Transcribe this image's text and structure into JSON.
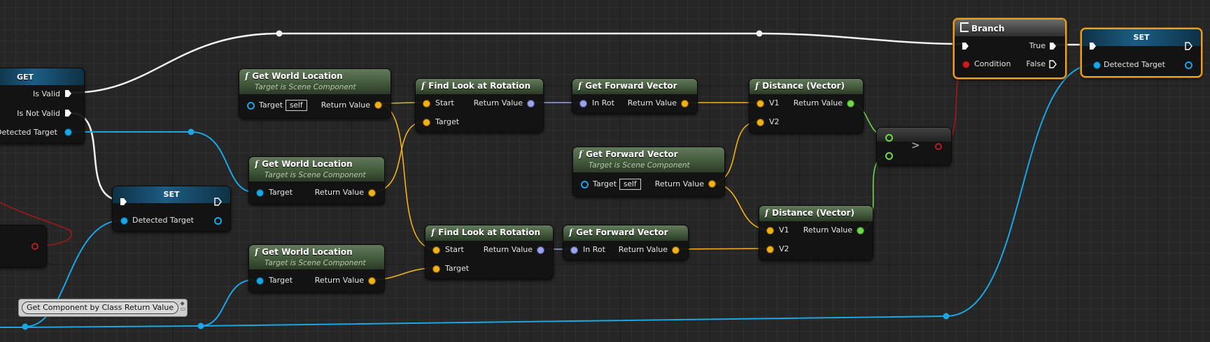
{
  "colors": {
    "exec": "#ffffff",
    "object": "#1ba6e6",
    "vector": "#f0b21c",
    "rotator": "#9aa5e8",
    "float": "#6ed84a",
    "bool": "#c81e1e",
    "selection": "#f0a020"
  },
  "nodes": {
    "get": {
      "title": "GET",
      "pins": [
        "Is Valid",
        "Is Not Valid",
        "Detected Target"
      ]
    },
    "set_mid": {
      "title": "SET",
      "pin": "Detected Target"
    },
    "gwl1": {
      "title": "Get World Location",
      "subtitle": "Target is Scene Component",
      "target": "Target",
      "self": "self",
      "ret": "Return Value"
    },
    "gwl2": {
      "title": "Get World Location",
      "subtitle": "Target is Scene Component",
      "target": "Target",
      "ret": "Return Value"
    },
    "gwl3": {
      "title": "Get World Location",
      "subtitle": "Target is Scene Component",
      "target": "Target",
      "ret": "Return Value"
    },
    "flr1": {
      "title": "Find Look at Rotation",
      "start": "Start",
      "target": "Target",
      "ret": "Return Value"
    },
    "flr2": {
      "title": "Find Look at Rotation",
      "start": "Start",
      "target": "Target",
      "ret": "Return Value"
    },
    "gfv1": {
      "title": "Get Forward Vector",
      "in": "In Rot",
      "ret": "Return Value"
    },
    "gfv2": {
      "title": "Get Forward Vector",
      "subtitle": "Target is Scene Component",
      "target": "Target",
      "self": "self",
      "ret": "Return Value"
    },
    "gfv3": {
      "title": "Get Forward Vector",
      "in": "In Rot",
      "ret": "Return Value"
    },
    "dist1": {
      "title": "Distance (Vector)",
      "v1": "V1",
      "v2": "V2",
      "ret": "Return Value"
    },
    "dist2": {
      "title": "Distance (Vector)",
      "v1": "V1",
      "v2": "V2",
      "ret": "Return Value"
    },
    "compare": {
      "symbol": ">"
    },
    "branch": {
      "title": "Branch",
      "cond": "Condition",
      "t": "True",
      "f": "False"
    },
    "set_right": {
      "title": "SET",
      "pin": "Detected Target"
    }
  },
  "comment": {
    "text": "Get Component by Class Return Value"
  }
}
